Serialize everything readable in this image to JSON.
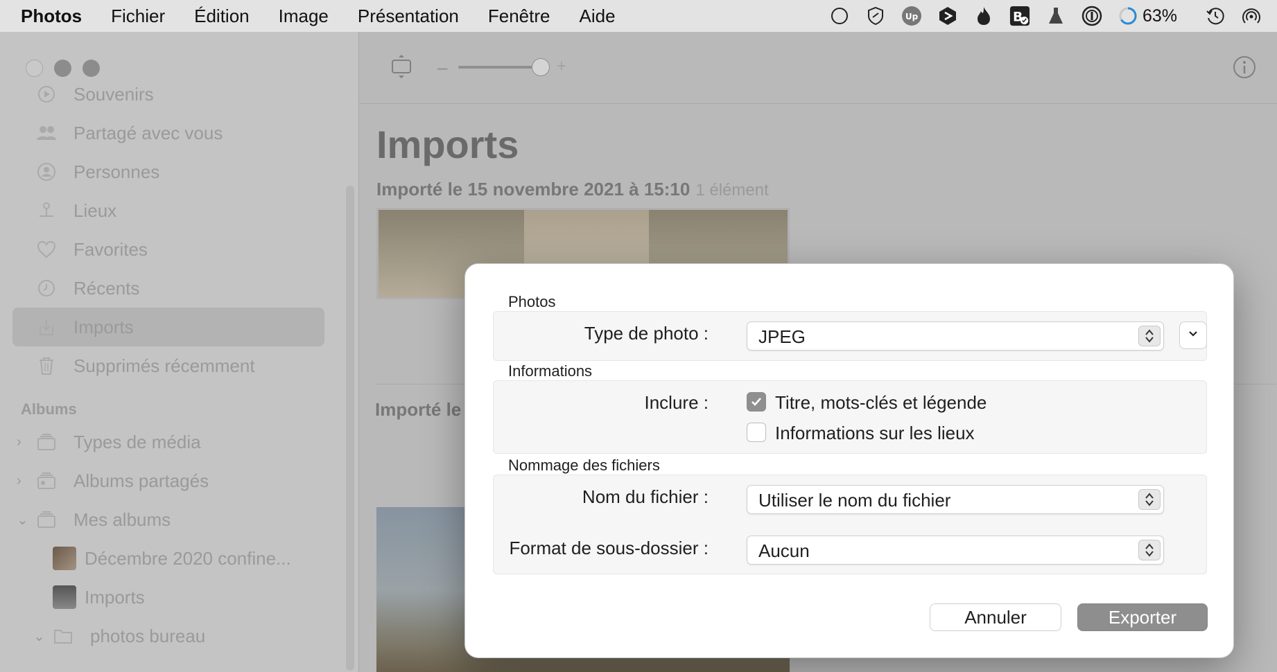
{
  "menubar": {
    "app": "Photos",
    "items": [
      "Fichier",
      "Édition",
      "Image",
      "Présentation",
      "Fenêtre",
      "Aide"
    ],
    "status_icons": [
      "circle-icon",
      "shield-link-icon",
      "upwork-icon",
      "shortcut-icon",
      "flame-icon",
      "bear-check-icon",
      "flask-icon",
      "onepassword-icon",
      "battery-ring-icon",
      "time-machine-icon",
      "airdrop-icon"
    ],
    "battery_percent": "63%"
  },
  "sidebar": {
    "items": [
      {
        "label": "Souvenirs",
        "icon": "memories-icon"
      },
      {
        "label": "Partagé avec vous",
        "icon": "people-share-icon"
      },
      {
        "label": "Personnes",
        "icon": "person-circle-icon"
      },
      {
        "label": "Lieux",
        "icon": "pin-icon"
      },
      {
        "label": "Favorites",
        "icon": "heart-icon"
      },
      {
        "label": "Récents",
        "icon": "clock-icon"
      },
      {
        "label": "Imports",
        "icon": "import-icon",
        "selected": true
      },
      {
        "label": "Supprimés récemment",
        "icon": "trash-icon"
      }
    ],
    "albums_header": "Albums",
    "albums": [
      {
        "label": "Types de média",
        "chevron": "›"
      },
      {
        "label": "Albums partagés",
        "chevron": "›"
      },
      {
        "label": "Mes albums",
        "chevron": "⌄"
      }
    ],
    "sub_albums": [
      {
        "label": "Décembre 2020  confine..."
      },
      {
        "label": "Imports"
      }
    ],
    "folder": {
      "label": "photos bureau",
      "chevron": "⌄"
    }
  },
  "main": {
    "title": "Imports",
    "import_date": "Importé le 15 novembre 2021 à 15:10",
    "import_count": "1 élément",
    "import_date_2": "Importé le"
  },
  "dialog": {
    "photos_section": "Photos",
    "photo_type_label": "Type de photo :",
    "photo_type_value": "JPEG",
    "info_section": "Informations",
    "include_label": "Inclure :",
    "include_title_keywords": "Titre, mots-clés et légende",
    "include_title_checked": true,
    "include_location": "Informations sur les lieux",
    "include_location_checked": false,
    "naming_section": "Nommage des fichiers",
    "filename_label": "Nom du fichier :",
    "filename_value": "Utiliser le nom du fichier",
    "subfolder_label": "Format de sous-dossier :",
    "subfolder_value": "Aucun",
    "cancel": "Annuler",
    "export": "Exporter"
  }
}
